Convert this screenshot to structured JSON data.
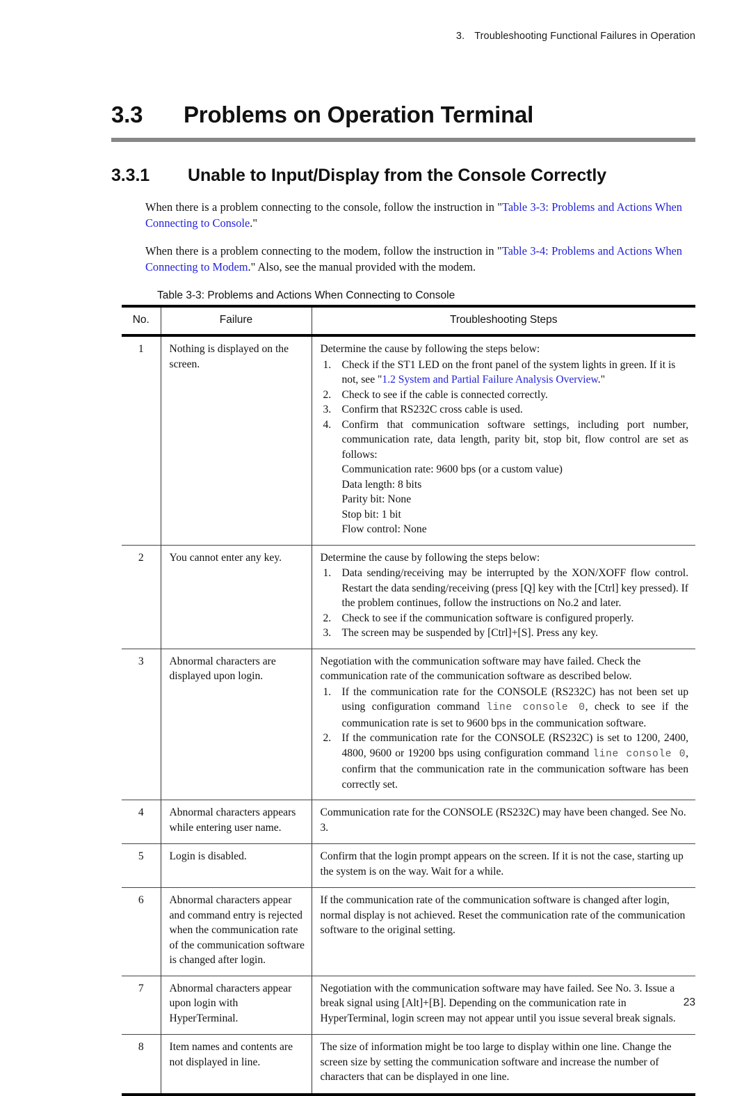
{
  "running_header": {
    "chapter_number": "3.",
    "chapter_title": "Troubleshooting Functional Failures in Operation"
  },
  "section": {
    "number": "3.3",
    "title": "Problems on Operation Terminal"
  },
  "subsection": {
    "number": "3.3.1",
    "title": "Unable to Input/Display from the Console Correctly"
  },
  "paragraphs": {
    "p1_before": "When there is a problem connecting to the console, follow the instruction in \"",
    "p1_link": "Table 3-3: Problems and Actions When Connecting to Console",
    "p1_after": ".\"",
    "p2_before": "When there is a problem connecting to the modem, follow the instruction in \"",
    "p2_link": "Table 3-4: Problems and Actions When Connecting to Modem",
    "p2_after": ".\" Also, see the manual provided with the modem."
  },
  "table": {
    "caption": "Table 3-3: Problems and Actions When Connecting to Console",
    "headers": {
      "no": "No.",
      "failure": "Failure",
      "steps": "Troubleshooting Steps"
    },
    "rows": [
      {
        "no": "1",
        "failure": "Nothing is displayed on the screen.",
        "intro": "Determine the cause by following the steps below:",
        "steps": [
          {
            "text_before_link": "Check if the ST1 LED on the front panel of the system lights in green. If it is not, see \"",
            "link": "1.2 System and Partial Failure Analysis Overview",
            "text_after_link": ".\""
          },
          {
            "text": "Check to see if the cable is connected correctly."
          },
          {
            "text": "Confirm that RS232C cross cable is used."
          },
          {
            "text": "Confirm that communication software settings, including port number, communication rate, data length, parity bit, stop bit, flow control are set as follows:",
            "sublines": [
              "Communication rate: 9600 bps (or a custom value)",
              "Data length: 8 bits",
              "Parity bit: None",
              "Stop bit: 1 bit",
              "Flow control: None"
            ]
          }
        ]
      },
      {
        "no": "2",
        "failure": "You cannot enter any key.",
        "intro": "Determine the cause by following the steps below:",
        "steps": [
          {
            "text": "Data sending/receiving may be interrupted by the XON/XOFF flow control. Restart the data sending/receiving (press [Q] key with the [Ctrl] key pressed). If the problem continues, follow the instructions on No.2 and later."
          },
          {
            "text": "Check to see if the communication software is configured properly."
          },
          {
            "text": "The screen may be suspended by [Ctrl]+[S]. Press any key."
          }
        ]
      },
      {
        "no": "3",
        "failure": "Abnormal characters are displayed upon login.",
        "intro": "Negotiation with the communication software may have failed. Check the communication rate of the communication software as described below.",
        "steps": [
          {
            "text_parts": [
              {
                "type": "text",
                "value": "If the communication rate for the CONSOLE (RS232C) has not been set up using configuration command "
              },
              {
                "type": "code",
                "value": "line console 0"
              },
              {
                "type": "text",
                "value": ", check to see if the communication rate is set to 9600 bps in the communication software."
              }
            ]
          },
          {
            "text_parts": [
              {
                "type": "text",
                "value": "If the communication rate for the CONSOLE (RS232C) is set to 1200, 2400, 4800, 9600 or 19200 bps using configuration command "
              },
              {
                "type": "code",
                "value": "line console 0"
              },
              {
                "type": "text",
                "value": ", confirm that the communication rate in the communication software has been correctly set."
              }
            ]
          }
        ]
      },
      {
        "no": "4",
        "failure": "Abnormal characters appears while entering user name.",
        "intro": "Communication rate for the CONSOLE (RS232C) may have been changed. See No. 3.",
        "steps": []
      },
      {
        "no": "5",
        "failure": "Login is disabled.",
        "intro": "Confirm that the login prompt appears on the screen. If it is not the case, starting up the system is on the way. Wait for a while.",
        "steps": []
      },
      {
        "no": "6",
        "failure": "Abnormal characters appear and command entry is rejected when the communication rate of the communication software is changed after login.",
        "intro": "If the communication rate of the communication software is changed after login, normal display is not achieved. Reset the communication rate of the communication software to the original setting.",
        "steps": []
      },
      {
        "no": "7",
        "failure": "Abnormal characters appear upon login with HyperTerminal.",
        "intro": "Negotiation with the communication software may have failed. See No. 3. Issue a break signal using [Alt]+[B]. Depending on the communication rate in HyperTerminal, login screen may not appear until you issue several break signals.",
        "steps": []
      },
      {
        "no": "8",
        "failure": "Item names and contents are not displayed in line.",
        "intro": "The size of information might be too large to display within one line. Change the screen size by setting the communication software and increase the number of characters that can be displayed in one line.",
        "steps": []
      }
    ]
  },
  "page_number": "23",
  "colors": {
    "link": "#2222dd",
    "rule_gray": "#878787",
    "code_text": "#555555"
  }
}
